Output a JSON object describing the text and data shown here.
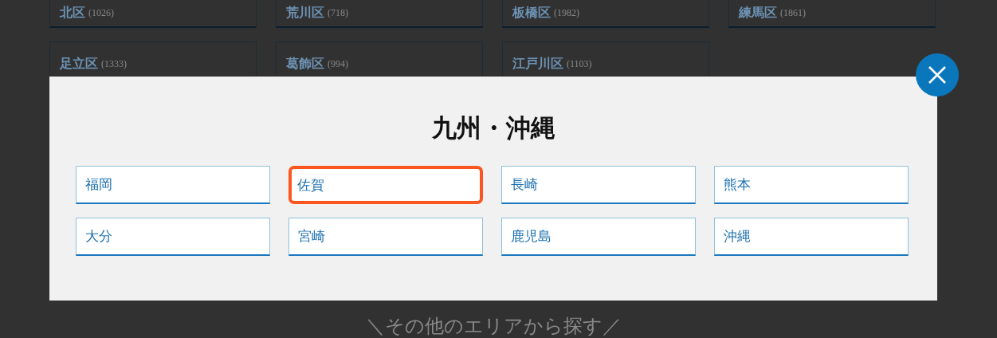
{
  "background": {
    "wards": [
      {
        "name": "北区",
        "count": "(1026)"
      },
      {
        "name": "荒川区",
        "count": "(718)"
      },
      {
        "name": "板橋区",
        "count": "(1982)"
      },
      {
        "name": "練馬区",
        "count": "(1861)"
      },
      {
        "name": "足立区",
        "count": "(1333)"
      },
      {
        "name": "葛飾区",
        "count": "(994)"
      },
      {
        "name": "江戸川区",
        "count": "(1103)"
      }
    ],
    "heading": "＼その他のエリアから探す／"
  },
  "modal": {
    "title": "九州・沖縄",
    "prefectures": [
      {
        "label": "福岡",
        "selected": false
      },
      {
        "label": "佐賀",
        "selected": true
      },
      {
        "label": "長崎",
        "selected": false
      },
      {
        "label": "熊本",
        "selected": false
      },
      {
        "label": "大分",
        "selected": false
      },
      {
        "label": "宮崎",
        "selected": false
      },
      {
        "label": "鹿児島",
        "selected": false
      },
      {
        "label": "沖縄",
        "selected": false
      }
    ]
  }
}
